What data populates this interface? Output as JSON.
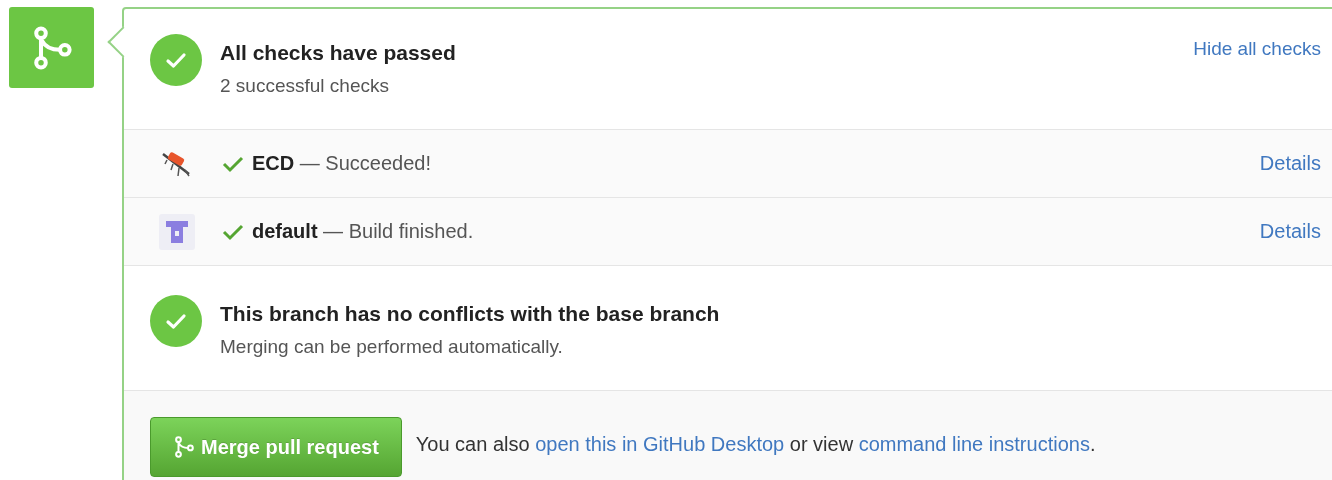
{
  "checks_summary": {
    "title": "All checks have passed",
    "subtitle": "2 successful checks",
    "toggle_link": "Hide all checks"
  },
  "checks": [
    {
      "kind": "ecd",
      "name": "ECD",
      "separator": "—",
      "description": "Succeeded!",
      "details_link": "Details"
    },
    {
      "kind": "default",
      "name": "default",
      "separator": "—",
      "description": "Build finished.",
      "details_link": "Details"
    }
  ],
  "merge_status": {
    "title": "This branch has no conflicts with the base branch",
    "subtitle": "Merging can be performed automatically."
  },
  "merge_button": "Merge pull request",
  "alternatives": {
    "prefix": "You can also",
    "desktop_link": "open this in GitHub Desktop",
    "middle": "or view",
    "cli_link": "command line instructions",
    "suffix": "."
  }
}
